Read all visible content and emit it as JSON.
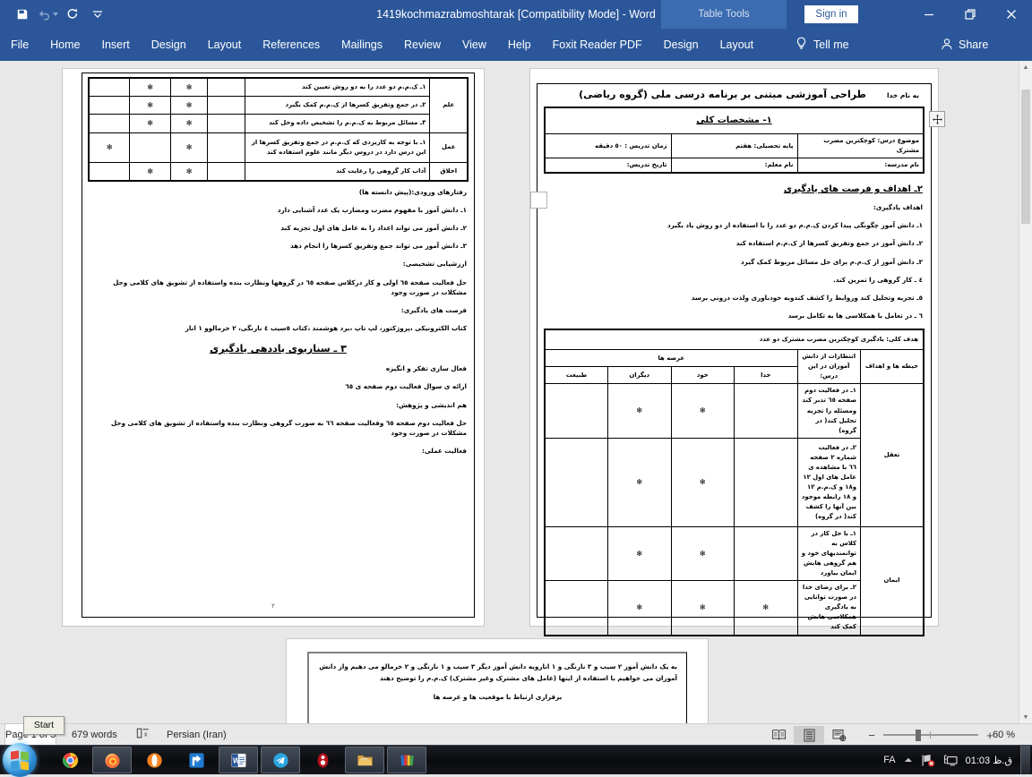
{
  "titlebar": {
    "document_title": "1419kochmazrabmoshtarak [Compatibility Mode]  -  Word",
    "contextual_tools_label": "Table Tools",
    "sign_in": "Sign in",
    "qat": [
      {
        "name": "save-button",
        "label": "Save"
      },
      {
        "name": "undo-button",
        "label": "Undo"
      },
      {
        "name": "redo-button",
        "label": "Repeat"
      },
      {
        "name": "customize-quick-access-toolbar-button",
        "label": "Customize Quick Access Toolbar"
      }
    ],
    "window_buttons": [
      {
        "name": "ribbon-display-options-button",
        "label": "Ribbon Display Options"
      },
      {
        "name": "minimize-button",
        "label": "Minimize"
      },
      {
        "name": "restore-button",
        "label": "Restore Down"
      },
      {
        "name": "close-button",
        "label": "Close"
      }
    ]
  },
  "ribbon": {
    "tabs": [
      {
        "label": "File"
      },
      {
        "label": "Home"
      },
      {
        "label": "Insert"
      },
      {
        "label": "Design"
      },
      {
        "label": "Layout"
      },
      {
        "label": "References"
      },
      {
        "label": "Mailings"
      },
      {
        "label": "Review"
      },
      {
        "label": "View"
      },
      {
        "label": "Help"
      },
      {
        "label": "Foxit Reader PDF"
      }
    ],
    "contextual_tabs": [
      {
        "label": "Design"
      },
      {
        "label": "Layout"
      }
    ],
    "tell_me": "Tell me",
    "share": "Share"
  },
  "document": {
    "page_left": {
      "page_number": "٢",
      "competency_table": {
        "rows": [
          {
            "domain": "علم",
            "items": [
              "١ـ ک.م.م دو عدد را به دو روش تعیین کند",
              "٢ـ در جمع وتفریق کسرها از ک.م.م کمک بگیرد",
              "٣ـ مسائل مربوط به ک.م.م را تشخیص داده وحل کند"
            ],
            "marks": [
              {
                "khoda": "",
                "khod": "✻",
                "digaran": "✻",
                "tabiat": ""
              },
              {
                "khoda": "",
                "khod": "✻",
                "digaran": "✻",
                "tabiat": ""
              },
              {
                "khoda": "",
                "khod": "✻",
                "digaran": "✻",
                "tabiat": ""
              }
            ]
          },
          {
            "domain": "عمل",
            "items": [
              "١ـ با توجه به کاربردی که ک.م.م در جمع وتفریق کسرها از این درس دارد در دروس دیگر مانند علوم استفاده کند"
            ],
            "marks": [
              {
                "khoda": "",
                "khod": "✻",
                "digaran": "",
                "tabiat": "✻"
              }
            ]
          },
          {
            "domain": "اخلاق",
            "items": [
              "آداب کار گروهی را رعایت کند"
            ],
            "marks": [
              {
                "khoda": "",
                "khod": "✻",
                "digaran": "✻",
                "tabiat": ""
              }
            ]
          }
        ]
      },
      "sections": [
        {
          "kind": "label",
          "text": "رفتارهای ورودی:(پیش دانسته ها)"
        },
        {
          "kind": "item",
          "text": "١ـ دانش آموز با مفهوم مضرب ومضارب یک عدد آشنایی دارد"
        },
        {
          "kind": "item",
          "text": "٢ـ دانش آموز می تواند اعداد را به عامل های اول تجزیه کند"
        },
        {
          "kind": "item",
          "text": "٣ـ دانش آموز می تواند جمع وتفریق کسرها را انجام دهد"
        },
        {
          "kind": "label",
          "text": "ارزشیابی تشخیصی:"
        },
        {
          "kind": "item",
          "text": "حل فعالیت صفحه ٦٥ اولی و کار درکلاس صفحه ٦٥ در گروهها ونظارت بنده واستفاده از تشویق های کلامی وحل مشکلات در صورت وجود"
        },
        {
          "kind": "label",
          "text": "فرصت های یادگیری:"
        },
        {
          "kind": "item",
          "text": "کتاب الکترونیکی ،پروژکتور، لپ تاپ ،برد هوشمند ،کتاب ٥سیب ٤ نارنگی، ٢ خرمالوو ١ انار"
        },
        {
          "kind": "heading",
          "text": "٣ ـ  سناریوی یاددهی یادگیری"
        },
        {
          "kind": "label",
          "text": "فعال سازی تفکر و انگیزه"
        },
        {
          "kind": "item",
          "text": "ارائه ی سوال فعالیت دوم صفحه ی ٦٥"
        },
        {
          "kind": "label",
          "text": "هم اندیشی و پژوهش:"
        },
        {
          "kind": "item",
          "text": "حل فعالیت دوم صفحه ٦٥ وفعالیت صفحه ٦٦ به صورت گروهی ونظارت بنده واستفاده از تشویق های کلامی وحل مشکلات در صورت وجود"
        },
        {
          "kind": "label",
          "text": "فعالیت عملی:"
        }
      ]
    },
    "page_right": {
      "header_bism": "به نام خدا",
      "header_title": "طراحی آموزشی  مبتنی بر برنامه درسی ملی (گروه ریاضی)",
      "info_table": {
        "title": "١- مشخصات کلی",
        "rows": [
          [
            {
              "label": "موضوع درس: کوچکترین مضرب مشترک"
            },
            {
              "label": "پایه تحصیلی: هفتم"
            },
            {
              "label": "زمان تدریس : ٥٠ دقیقه"
            }
          ],
          [
            {
              "label": "نام مدرسه:"
            },
            {
              "label": "نام معلم:"
            },
            {
              "label": "تاریخ تدریس:"
            }
          ]
        ]
      },
      "objectives_heading": "٢ـ اهداف و فرصت های یادگیری",
      "objectives_label": "اهداف یادگیری:",
      "objectives": [
        "١ـ دانش آموز چگونگی پیدا کردن ک.م.م دو عدد را با استفاده از دو روش یاد بگیرد",
        "٢ـ دانش آموز در جمع وتفریق کسرها از ک.م.م استفاده کند",
        "٣ـ دانش آموز از ک.م.م برای حل مسائل مربوط کمک گیرد",
        "٤ ـ کار گروهی را تمرین کند.",
        "٥ـ تجزیه وتحلیل کند وروابط را کشف کندوبه خودباوری ولذت درونی برسد",
        "٦ ـ در تعامل با همکلاسی ها به تکامل برسد"
      ],
      "goal_table": {
        "overall_goal": "هدف کلی: یادگیری کوچکترین مضرب مشترک دو عدد",
        "col_domain": "حیطه ها و اهداف",
        "col_expectations": "انتظارات از دانش آموزان در این درس:",
        "col_arenas_group": "عرصه ها",
        "col_arenas": [
          "خدا",
          "خود",
          "دیگران",
          "طبیعت"
        ],
        "rows": [
          {
            "domain": "تعقل",
            "items": [
              "١ـ در فعالیت دوم صفحه ٦٥ تدبر کند ومسئله را تجزیه تحلیل کند( در گروه)",
              "٢ـ در فعالیت شماره ٢ صفحه ٦٦ با مشاهده ی عامل های اول ١٢ و١٨ و ک.م.م ١٢ و ١٨ رابطه موجود بین آنها را کشف کند( در گروه)"
            ],
            "marks": [
              {
                "khoda": "",
                "khod": "✻",
                "digaran": "✻",
                "tabiat": ""
              },
              {
                "khoda": "",
                "khod": "✻",
                "digaran": "✻",
                "tabiat": ""
              }
            ]
          },
          {
            "domain": "ایمان",
            "items": [
              "١ـ با حل کار در کلاس به توانمندیهای خود و هم گروهی هایش ایمان بیاورد",
              "٢ـ برای رضای خدا در صورت توانایی به یادگیری همکلاسی هایش کمک کند"
            ],
            "marks": [
              {
                "khoda": "",
                "khod": "✻",
                "digaran": "✻",
                "tabiat": ""
              },
              {
                "khoda": "✻",
                "khod": "✻",
                "digaran": "✻",
                "tabiat": ""
              }
            ]
          }
        ]
      }
    },
    "page_bottom": {
      "paragraph": "به یک دانش آموز ٢ سیب و ٣ نارنگی و ١ انارویه دانش آموز دیگر ٣ سیب و ١ نارنگی و ٢ خرمالو می دهیم واز دانش آموزان می خواهیم با استفاده از اینها (عامل های مشترک وغیر مشترک) ک.م.م را توضیح دهند",
      "line2": "برقراری ارتباط با موقعیت ها و عرصه ها"
    }
  },
  "statusbar": {
    "page_indicator": "Page 1 of 3",
    "word_count": "679 words",
    "proofing_icon": "proofing-errors-icon",
    "language": "Persian (Iran)",
    "view_buttons": [
      {
        "name": "read-mode-button",
        "label": "Read Mode"
      },
      {
        "name": "print-layout-button",
        "label": "Print Layout"
      },
      {
        "name": "web-layout-button",
        "label": "Web Layout"
      }
    ],
    "zoom_out": "−",
    "zoom_in": "+",
    "zoom_level": "60 %"
  },
  "taskbar": {
    "start_tooltip": "Start",
    "items": [
      {
        "name": "taskbar-item-chrome",
        "label": "Google Chrome",
        "running": false
      },
      {
        "name": "taskbar-item-firefox",
        "label": "Mozilla Firefox",
        "running": true
      },
      {
        "name": "taskbar-item-opera",
        "label": "Opera",
        "running": false
      },
      {
        "name": "taskbar-item-share",
        "label": "Share",
        "running": false
      },
      {
        "name": "taskbar-item-word",
        "label": "Microsoft Word",
        "running": true
      },
      {
        "name": "taskbar-item-telegram",
        "label": "Telegram",
        "running": true
      },
      {
        "name": "taskbar-item-idm",
        "label": "Internet Download Manager",
        "running": false
      },
      {
        "name": "taskbar-item-file-explorer",
        "label": "File Explorer",
        "running": true
      },
      {
        "name": "taskbar-item-winrar",
        "label": "WinRAR",
        "running": true
      }
    ],
    "tray": {
      "language": "FA",
      "show_hidden_icons": "show-hidden-icons-chevron",
      "network_icon": "network-disconnected-icon",
      "display_icon": "display-icon",
      "clock": "01:03 ق.ظ"
    }
  }
}
